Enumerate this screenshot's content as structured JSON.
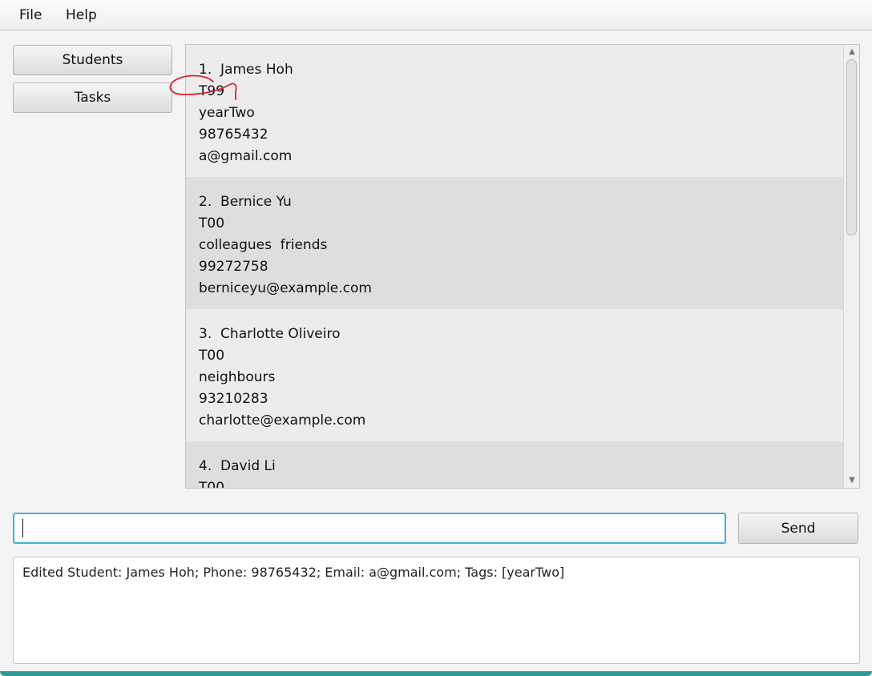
{
  "menu": {
    "file": "File",
    "help": "Help"
  },
  "sidebar": {
    "students": "Students",
    "tasks": "Tasks"
  },
  "students": [
    {
      "index": "1.",
      "name": "James Hoh",
      "code": "T99",
      "tags": "yearTwo",
      "phone": "98765432",
      "email": "a@gmail.com"
    },
    {
      "index": "2.",
      "name": "Bernice Yu",
      "code": "T00",
      "tags": "colleagues  friends",
      "phone": "99272758",
      "email": "berniceyu@example.com"
    },
    {
      "index": "3.",
      "name": "Charlotte Oliveiro",
      "code": "T00",
      "tags": "neighbours",
      "phone": "93210283",
      "email": "charlotte@example.com"
    },
    {
      "index": "4.",
      "name": "David Li",
      "code": "T00",
      "tags": "",
      "phone": "",
      "email": ""
    }
  ],
  "command": {
    "value": "",
    "send_label": "Send"
  },
  "result": {
    "text": "Edited Student: James Hoh; Phone: 98765432; Email: a@gmail.com; Tags: [yearTwo]"
  },
  "colors": {
    "input_focus": "#40b0d8",
    "annotation": "#d9262c",
    "window_accent": "#2f9a96"
  }
}
